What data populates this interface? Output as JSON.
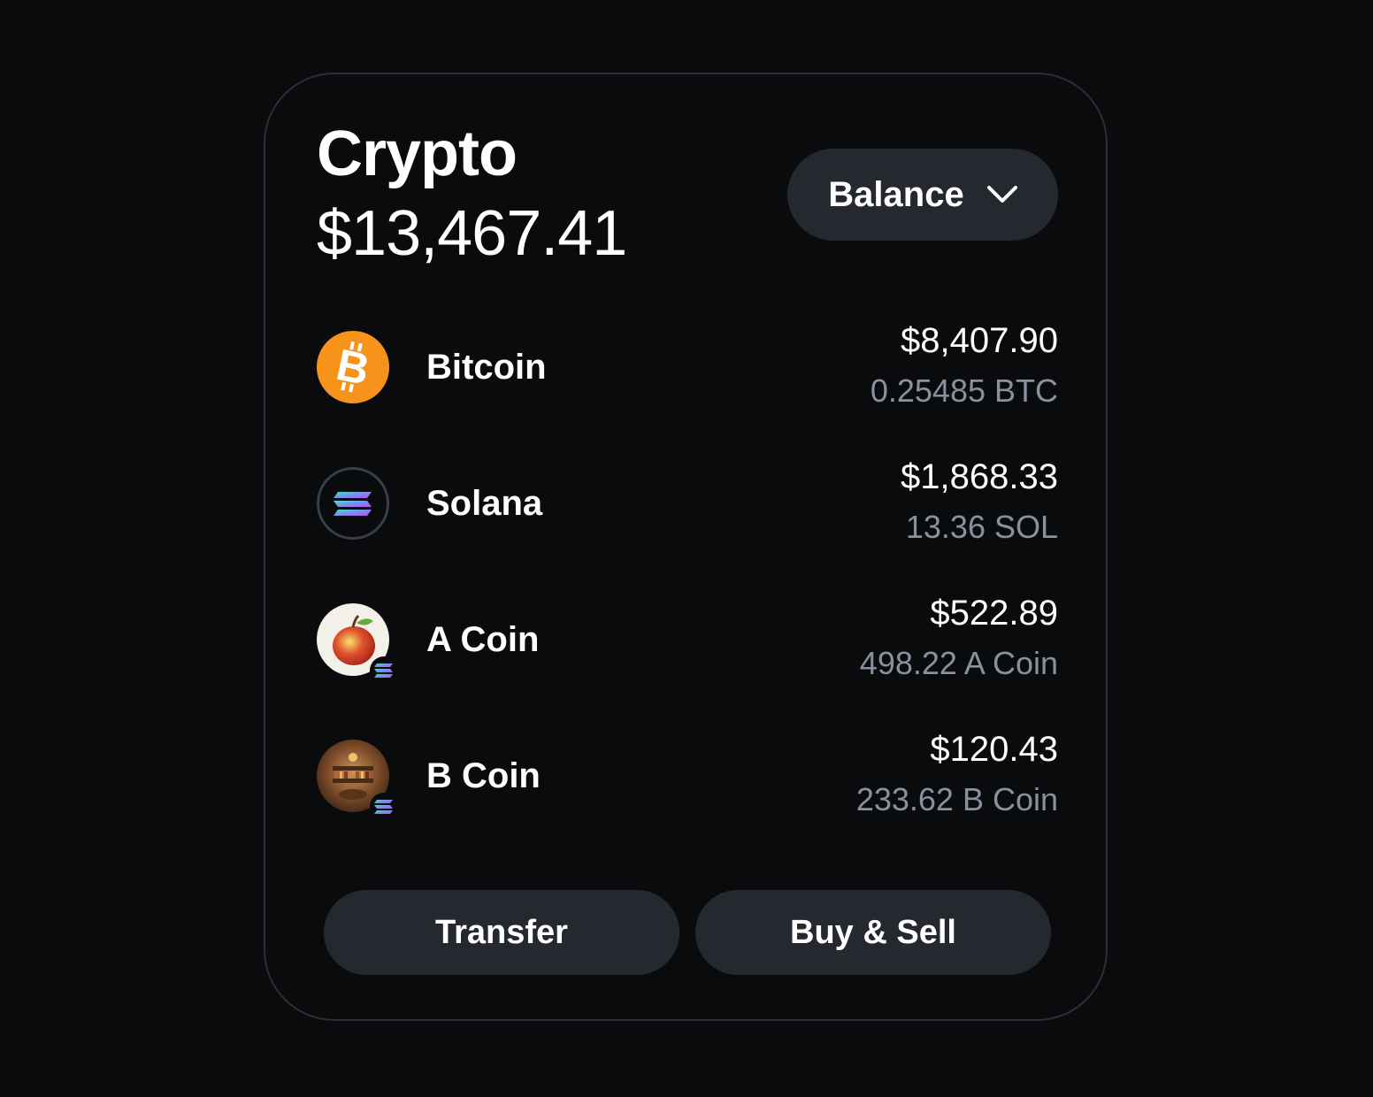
{
  "header": {
    "title": "Crypto",
    "total_balance": "$13,467.41",
    "sort_dropdown_label": "Balance"
  },
  "assets": [
    {
      "name": "Bitcoin",
      "usd_value": "$8,407.90",
      "amount": "0.25485 BTC",
      "icon": "bitcoin-icon",
      "icon_color": "#f7931a"
    },
    {
      "name": "Solana",
      "usd_value": "$1,868.33",
      "amount": "13.36 SOL",
      "icon": "solana-icon"
    },
    {
      "name": "A Coin",
      "usd_value": "$522.89",
      "amount": "498.22 A Coin",
      "icon": "apple-icon",
      "network_badge": "solana-icon"
    },
    {
      "name": "B Coin",
      "usd_value": "$120.43",
      "amount": "233.62 B Coin",
      "icon": "library-icon",
      "network_badge": "solana-icon"
    }
  ],
  "actions": {
    "transfer_label": "Transfer",
    "buy_sell_label": "Buy & Sell"
  },
  "colors": {
    "background": "#0a0b0d",
    "button_bg": "#25282e",
    "secondary_text": "#8a919e",
    "card_border": "#2b2e35"
  }
}
